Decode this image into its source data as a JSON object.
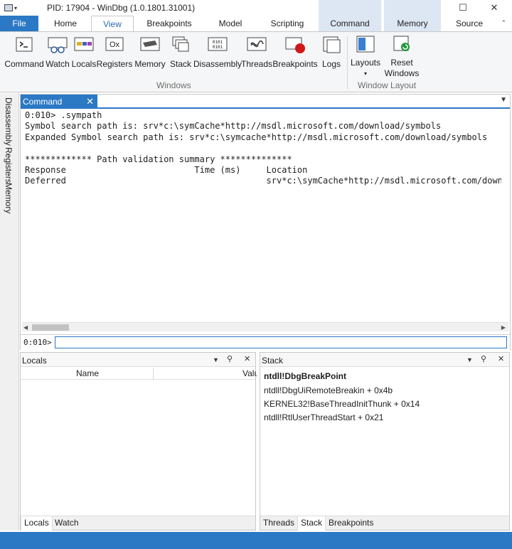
{
  "window": {
    "title": "PID: 17904 - WinDbg (1.0.1801.31001)",
    "controls": {
      "minimize": "—",
      "maximize": "☐",
      "close": "✕"
    }
  },
  "ribbon": {
    "tabs": [
      {
        "label": "File"
      },
      {
        "label": "Home"
      },
      {
        "label": "View"
      },
      {
        "label": "Breakpoints"
      },
      {
        "label": "Model"
      },
      {
        "label": "Scripting"
      },
      {
        "label": "Command"
      },
      {
        "label": "Memory"
      },
      {
        "label": "Source"
      }
    ],
    "windows_group": {
      "label": "Windows",
      "buttons": [
        {
          "label": "Command",
          "icon": "command-window-icon"
        },
        {
          "label": "Watch",
          "icon": "watch-glasses-icon"
        },
        {
          "label": "Locals",
          "icon": "locals-icon"
        },
        {
          "label": "Registers",
          "icon": "registers-icon",
          "glyph": "Ox"
        },
        {
          "label": "Memory",
          "icon": "memory-chip-icon"
        },
        {
          "label": "Stack",
          "icon": "stack-icon"
        },
        {
          "label": "Disassembly",
          "icon": "disassembly-icon",
          "glyph": "0101"
        },
        {
          "label": "Threads",
          "icon": "threads-icon"
        },
        {
          "label": "Breakpoints",
          "icon": "breakpoint-dot-icon"
        },
        {
          "label": "Logs",
          "icon": "logs-icon"
        }
      ]
    },
    "layout_group": {
      "label": "Window Layout",
      "layouts": "Layouts",
      "reset_line1": "Reset",
      "reset_line2": "Windows"
    }
  },
  "side_tabs": [
    "Disassembly",
    "Registers",
    "Memory"
  ],
  "command_pane": {
    "tab": "Command",
    "output": "0:010> .sympath\nSymbol search path is: srv*c:\\symCache*http://msdl.microsoft.com/download/symbols\nExpanded Symbol search path is: srv*c:\\symcache*http://msdl.microsoft.com/download/symbols\n\n************* Path validation summary **************\nResponse                         Time (ms)     Location\nDeferred                                       srv*c:\\symCache*http://msdl.microsoft.com/download/symbols",
    "prompt": "0:010>",
    "input_value": ""
  },
  "locals_pane": {
    "title": "Locals",
    "columns": [
      "Name",
      "Value"
    ],
    "bottom_tabs": [
      "Locals",
      "Watch"
    ]
  },
  "stack_pane": {
    "title": "Stack",
    "frames": [
      "ntdll!DbgBreakPoint",
      "ntdll!DbgUiRemoteBreakin + 0x4b",
      "KERNEL32!BaseThreadInitThunk + 0x14",
      "ntdll!RtlUserThreadStart + 0x21"
    ],
    "bottom_tabs": [
      "Threads",
      "Stack",
      "Breakpoints"
    ]
  },
  "colors": {
    "accent": "#2b78c5",
    "context_tab": "#dde7f3"
  }
}
